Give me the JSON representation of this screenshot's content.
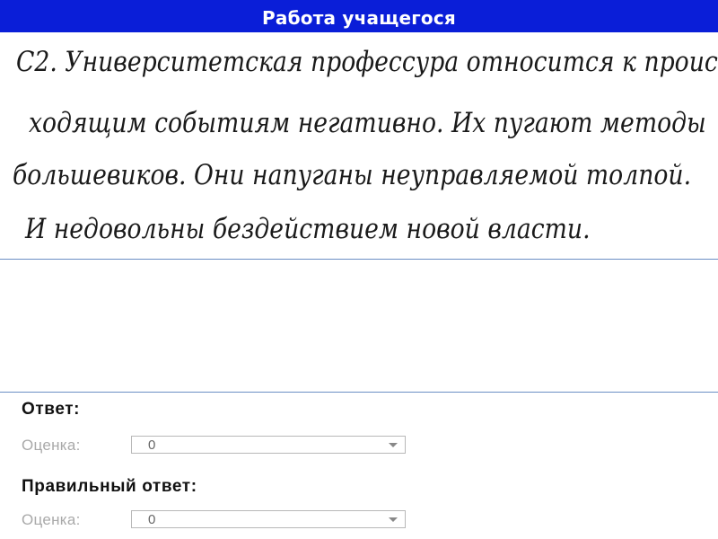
{
  "header": {
    "title": "Работа учащегося"
  },
  "student_work": {
    "lines": [
      "С2. Университетская профессура относится к проис-",
      "ходящим событиям негативно. Их пугают методы",
      "большевиков. Они напуганы неуправляемой толпой.",
      "И недовольны бездействием новой власти."
    ]
  },
  "answer": {
    "label": "Ответ:",
    "grade_label": "Оценка:",
    "grade_value": "0"
  },
  "correct_answer": {
    "label": "Правильный ответ:",
    "grade_label": "Оценка:",
    "grade_value": "0"
  }
}
